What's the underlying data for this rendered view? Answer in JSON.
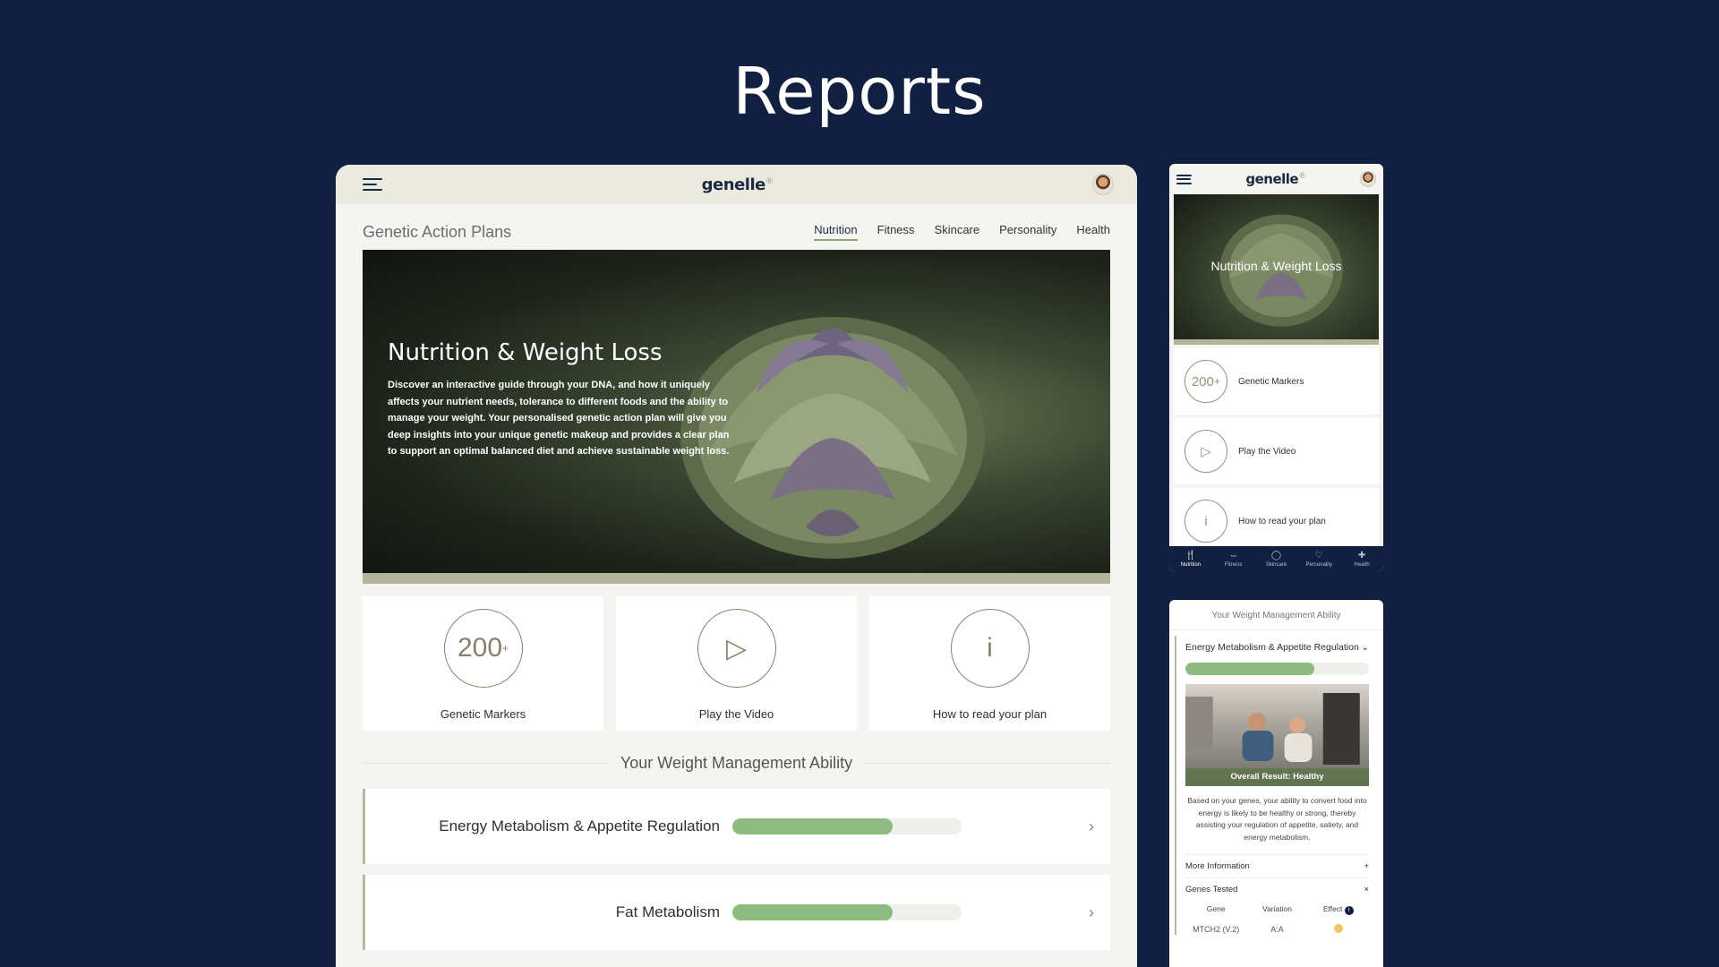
{
  "page": {
    "title": "Reports"
  },
  "desktop": {
    "logo": "genelle",
    "logo_mark": "®",
    "section_title": "Genetic Action Plans",
    "tabs": [
      {
        "label": "Nutrition",
        "active": true
      },
      {
        "label": "Fitness",
        "active": false
      },
      {
        "label": "Skincare",
        "active": false
      },
      {
        "label": "Personality",
        "active": false
      },
      {
        "label": "Health",
        "active": false
      }
    ],
    "hero": {
      "title": "Nutrition & Weight Loss",
      "description": "Discover an interactive guide through your DNA, and how it uniquely affects your nutrient needs, tolerance to different foods and the ability to manage your weight. Your personalised genetic action plan will give you deep insights into your unique genetic makeup and provides a clear plan to support an optimal balanced diet and achieve sustainable weight loss."
    },
    "cards": [
      {
        "icon_text": "200",
        "icon_sup": "+",
        "label": "Genetic Markers"
      },
      {
        "icon_text": "▷",
        "label": "Play the Video"
      },
      {
        "icon_text": "i",
        "label": "How to read your plan"
      }
    ],
    "weight_section_title": "Your Weight Management Ability",
    "rows": [
      {
        "label": "Energy Metabolism & Appetite Regulation",
        "progress": 0.7
      },
      {
        "label": "Fat Metabolism",
        "progress": 0.7
      }
    ]
  },
  "mobile1": {
    "logo": "genelle",
    "logo_mark": "®",
    "hero_title": "Nutrition & Weight Loss",
    "items": [
      {
        "icon_text": "200",
        "icon_sup": "+",
        "label": "Genetic Markers"
      },
      {
        "icon_text": "▷",
        "label": "Play the Video"
      },
      {
        "icon_text": "i",
        "label": "How to read your plan"
      }
    ],
    "nav": [
      {
        "label": "Nutrition",
        "icon": "🍴",
        "active": true
      },
      {
        "label": "Fitness",
        "icon": "⇔",
        "active": false
      },
      {
        "label": "Skincare",
        "icon": "◯",
        "active": false
      },
      {
        "label": "Personality",
        "icon": "♡",
        "active": false
      },
      {
        "label": "Health",
        "icon": "✚",
        "active": false
      }
    ]
  },
  "mobile2": {
    "header": "Your Weight Management Ability",
    "title": "Energy Metabolism & Appetite Regulation",
    "progress": 0.7,
    "photo_result": "Overall Result: Healthy",
    "description": "Based on your genes, your ability to convert food into energy is likely to be healthy or strong, thereby assisting your regulation of appetite, satiety, and energy metabolism.",
    "more_info": "More Information",
    "genes_tested": "Genes Tested",
    "genes_columns": [
      "Gene",
      "Variation",
      "Effect"
    ],
    "genes_rows": [
      {
        "gene": "MTCH2 (V.2)",
        "variation": "A:A"
      }
    ],
    "colors": {
      "effect_dot": "#f1c75f",
      "bar_fill": "#8ebc80",
      "background": "#112041"
    }
  }
}
